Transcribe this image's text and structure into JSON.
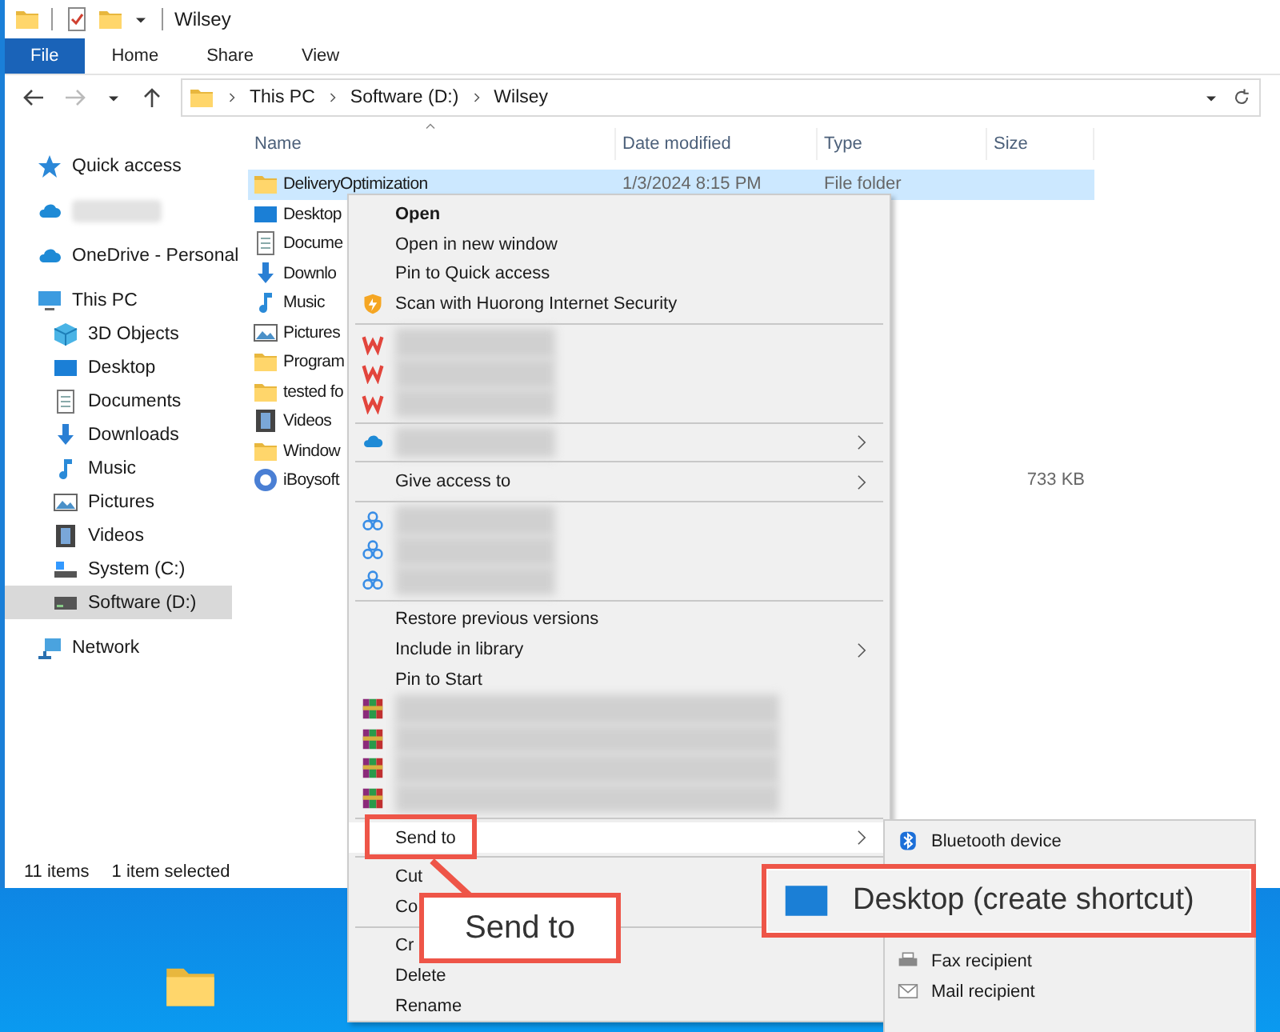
{
  "window": {
    "title": "Wilsey"
  },
  "ribbon_tabs": [
    {
      "label": "File",
      "selected": true
    },
    {
      "label": "Home",
      "selected": false
    },
    {
      "label": "Share",
      "selected": false
    },
    {
      "label": "View",
      "selected": false
    }
  ],
  "address_bar": {
    "path": [
      "This PC",
      "Software (D:)",
      "Wilsey"
    ]
  },
  "sidebar": {
    "items": [
      {
        "kind": "item",
        "label": "Quick access",
        "selected": false
      },
      {
        "kind": "blurred",
        "selected": false
      },
      {
        "kind": "item",
        "label": "OneDrive - Personal",
        "selected": false
      },
      {
        "kind": "item",
        "label": "This PC",
        "selected": false,
        "children": [
          {
            "label": "3D Objects",
            "selected": false
          },
          {
            "label": "Desktop",
            "selected": false
          },
          {
            "label": "Documents",
            "selected": false
          },
          {
            "label": "Downloads",
            "selected": false
          },
          {
            "label": "Music",
            "selected": false
          },
          {
            "label": "Pictures",
            "selected": false
          },
          {
            "label": "Videos",
            "selected": false
          },
          {
            "label": "System (C:)",
            "selected": false
          },
          {
            "label": "Software (D:)",
            "selected": true
          }
        ]
      },
      {
        "kind": "item",
        "label": "Network",
        "selected": false
      }
    ]
  },
  "file_list": {
    "columns": [
      "Name",
      "Date modified",
      "Type",
      "Size"
    ],
    "rows": [
      {
        "name": "DeliveryOptimization",
        "date": "1/3/2024 8:15 PM",
        "type": "File folder",
        "selected": true
      },
      {
        "name": "Desktop",
        "selected": false
      },
      {
        "name": "Docume",
        "selected": false
      },
      {
        "name": "Downlo",
        "selected": false
      },
      {
        "name": "Music",
        "selected": false
      },
      {
        "name": "Pictures",
        "selected": false
      },
      {
        "name": "Program",
        "selected": false
      },
      {
        "name": "tested fo",
        "selected": false
      },
      {
        "name": "Videos",
        "selected": false
      },
      {
        "name": "Window",
        "selected": false
      },
      {
        "name": "iBoysoft",
        "size": "733 KB",
        "selected": false
      }
    ]
  },
  "status_bar": {
    "count": "11 items",
    "selection": "1 item selected"
  },
  "context_menu": {
    "items": [
      {
        "kind": "item",
        "label": "Open",
        "bold": true,
        "selected": false
      },
      {
        "kind": "item",
        "label": "Open in new window",
        "bold": false,
        "selected": false
      },
      {
        "kind": "item",
        "label": "Pin to Quick access",
        "bold": false,
        "selected": false
      },
      {
        "kind": "item",
        "label": "Scan with Huorong Internet Security",
        "bold": false,
        "selected": false
      },
      {
        "kind": "separator"
      },
      {
        "kind": "blurred"
      },
      {
        "kind": "blurred"
      },
      {
        "kind": "blurred"
      },
      {
        "kind": "separator"
      },
      {
        "kind": "blurred",
        "submenu": true
      },
      {
        "kind": "separator"
      },
      {
        "kind": "item",
        "label": "Give access to",
        "bold": false,
        "submenu": true,
        "selected": false
      },
      {
        "kind": "separator"
      },
      {
        "kind": "blurred"
      },
      {
        "kind": "blurred"
      },
      {
        "kind": "blurred"
      },
      {
        "kind": "separator"
      },
      {
        "kind": "item",
        "label": "Restore previous versions",
        "bold": false,
        "selected": false
      },
      {
        "kind": "item",
        "label": "Include in library",
        "bold": false,
        "submenu": true,
        "selected": false
      },
      {
        "kind": "item",
        "label": "Pin to Start",
        "bold": false,
        "selected": false
      },
      {
        "kind": "blurred"
      },
      {
        "kind": "blurred"
      },
      {
        "kind": "blurred"
      },
      {
        "kind": "blurred"
      },
      {
        "kind": "separator"
      },
      {
        "kind": "item",
        "label": "Send to",
        "bold": false,
        "submenu": true,
        "selected": true
      },
      {
        "kind": "separator"
      },
      {
        "kind": "item",
        "label": "Cut",
        "bold": false,
        "selected": false
      },
      {
        "kind": "item",
        "label": "Co",
        "bold": false,
        "selected": false
      },
      {
        "kind": "separator"
      },
      {
        "kind": "item",
        "label": "Cr",
        "bold": false,
        "selected": false
      },
      {
        "kind": "item",
        "label": "Delete",
        "bold": false,
        "selected": false
      },
      {
        "kind": "item",
        "label": "Rename",
        "bold": false,
        "selected": false
      }
    ]
  },
  "send_to_menu": {
    "items": [
      {
        "label": "Bluetooth device"
      },
      {
        "label": "Fax recipient"
      },
      {
        "label": "Mail recipient"
      }
    ]
  },
  "callouts": [
    {
      "label": "Send to"
    },
    {
      "label": "Desktop (create shortcut)"
    }
  ]
}
